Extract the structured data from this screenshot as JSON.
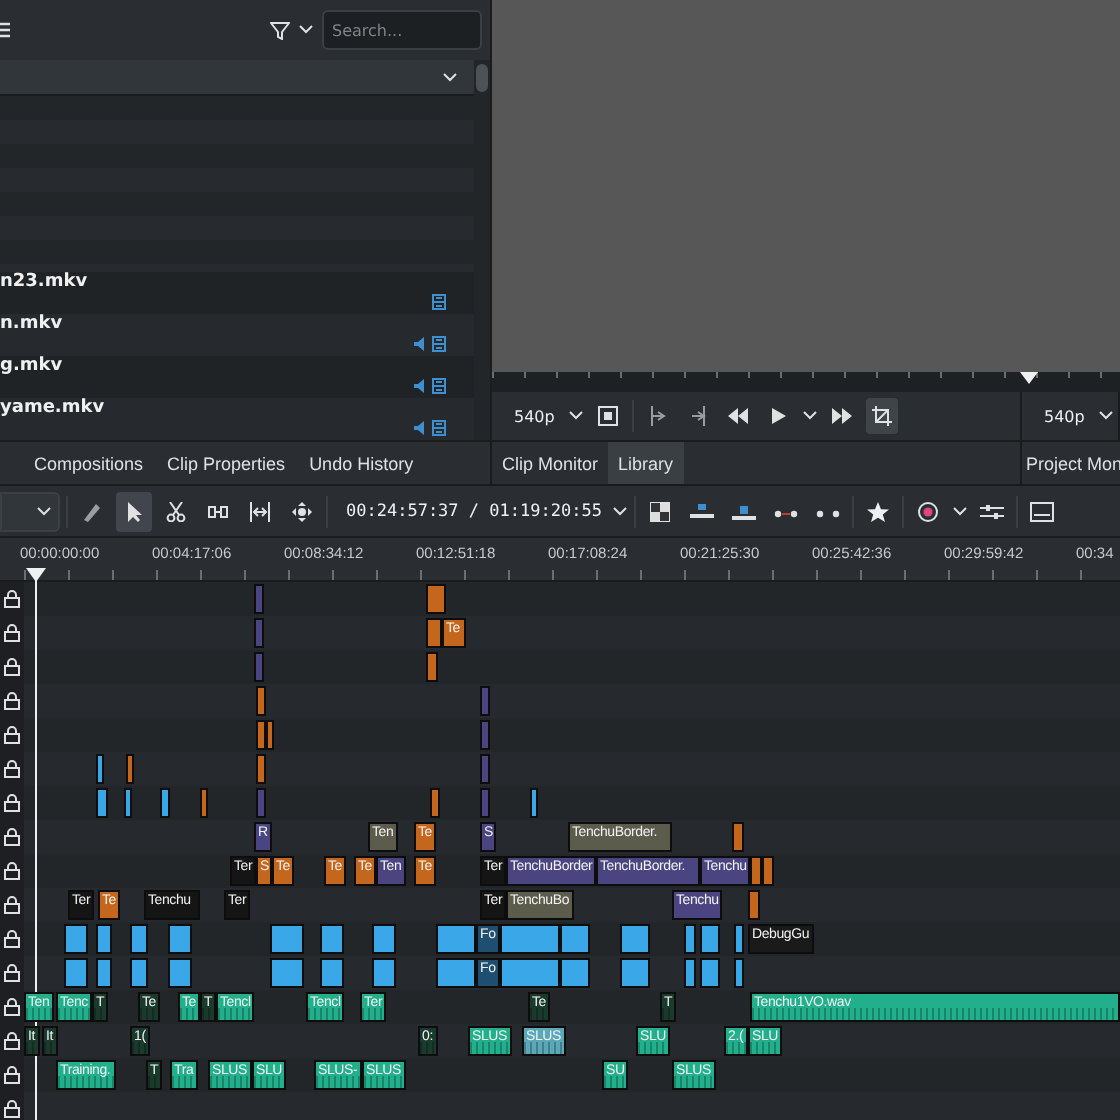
{
  "bin": {
    "search": {
      "placeholder": "Search..."
    },
    "items": [
      {
        "name": "n23.mkv",
        "audio": false
      },
      {
        "name": "n.mkv",
        "audio": true
      },
      {
        "name": "g.mkv",
        "audio": true
      },
      {
        "name": "yame.mkv",
        "audio": true
      }
    ]
  },
  "dock_tabs": [
    {
      "label": "Compositions",
      "selected": false
    },
    {
      "label": "Clip Properties",
      "selected": false
    },
    {
      "label": "Undo History",
      "selected": false
    }
  ],
  "clip_monitor": {
    "resolution": "540p",
    "crop_on": true,
    "tabs": [
      {
        "label": "Clip Monitor",
        "selected": false
      },
      {
        "label": "Library",
        "selected": true
      }
    ]
  },
  "project_monitor": {
    "resolution": "540p",
    "tab": "Project Mon"
  },
  "timeline": {
    "tools": [
      {
        "kind": "edit-mode",
        "selected": false
      },
      {
        "kind": "select",
        "selected": true
      },
      {
        "kind": "razor",
        "selected": false
      },
      {
        "kind": "spacer",
        "selected": false
      },
      {
        "kind": "ripple",
        "selected": false
      },
      {
        "kind": "slip",
        "selected": false
      }
    ],
    "timecode": "00:24:57:37 / 01:19:20:55",
    "ruler": [
      "00:00:00:00",
      "00:04:17:06",
      "00:08:34:12",
      "00:12:51:18",
      "00:17:08:24",
      "00:21:25:30",
      "00:25:42:36",
      "00:29:59:42",
      "00:34"
    ],
    "tracks": [
      {
        "locked": true,
        "clips": [
          {
            "color": "#4a4580"
          },
          {
            "color": "#c4661c"
          }
        ]
      },
      {
        "locked": true,
        "clips": [
          {
            "color": "#4a4580"
          },
          {
            "color": "#c4661c"
          },
          {
            "color": "#c4661c",
            "label": "Te"
          }
        ]
      },
      {
        "locked": true,
        "clips": [
          {
            "color": "#4a4580"
          },
          {
            "color": "#c4661c"
          }
        ]
      },
      {
        "locked": true,
        "clips": [
          {
            "color": "#c4661c"
          },
          {
            "color": "#4a4580"
          }
        ]
      },
      {
        "locked": true,
        "clips": [
          {
            "color": "#c4661c"
          },
          {
            "color": "#c4661c"
          },
          {
            "color": "#4a4580"
          }
        ]
      },
      {
        "locked": true,
        "clips": [
          {
            "color": "#3aa8e8"
          },
          {
            "color": "#c4661c"
          },
          {
            "color": "#c4661c"
          },
          {
            "color": "#4a4580"
          }
        ]
      },
      {
        "locked": true,
        "clips": [
          {
            "color": "#3aa8e8"
          },
          {
            "color": "#3aa8e8"
          },
          {
            "color": "#3aa8e8"
          },
          {
            "color": "#c4661c"
          },
          {
            "color": "#4a4580"
          },
          {
            "color": "#c4661c"
          },
          {
            "color": "#4a4580"
          },
          {
            "color": "#3aa8e8"
          }
        ]
      },
      {
        "locked": true,
        "clips": [
          {
            "color": "#4a4580",
            "label": "R"
          },
          {
            "color": "#5c5c4c",
            "label": "Ten"
          },
          {
            "color": "#c4661c",
            "label": "Te"
          },
          {
            "color": "#4a4580",
            "label": "S"
          },
          {
            "color": "#5c5c4c",
            "label": "TenchuBorder."
          },
          {
            "color": "#c4661c"
          }
        ]
      },
      {
        "locked": true,
        "clips": [
          {
            "color": "#151515",
            "label": "Ter"
          },
          {
            "color": "#c4661c",
            "label": "S"
          },
          {
            "color": "#c4661c",
            "label": "Te"
          },
          {
            "color": "#c4661c",
            "label": "Te"
          },
          {
            "color": "#c4661c",
            "label": "Te"
          },
          {
            "color": "#4a4580",
            "label": "Ten"
          },
          {
            "color": "#c4661c",
            "label": "Te"
          },
          {
            "color": "#151515",
            "label": "Ter"
          },
          {
            "color": "#4a4580",
            "label": "TenchuBorder"
          },
          {
            "color": "#4a4580",
            "label": "TenchuBorder."
          },
          {
            "color": "#4a4580",
            "label": "Tenchu"
          },
          {
            "color": "#c4661c"
          },
          {
            "color": "#c4661c"
          }
        ]
      },
      {
        "locked": true,
        "clips": [
          {
            "color": "#151515",
            "label": "Ter"
          },
          {
            "color": "#c4661c",
            "label": "Te"
          },
          {
            "color": "#151515",
            "label": "Tenchu"
          },
          {
            "color": "#151515",
            "label": "Ter"
          },
          {
            "color": "#151515",
            "label": "Ter"
          },
          {
            "color": "#5c5c4c",
            "label": "TenchuBo"
          },
          {
            "color": "#4a4580",
            "label": "Tenchu"
          },
          {
            "color": "#c4661c"
          }
        ]
      },
      {
        "locked": true,
        "clips": [
          {
            "color": "#3aa8e8"
          },
          {
            "color": "#3aa8e8"
          },
          {
            "color": "#3aa8e8"
          },
          {
            "color": "#3aa8e8"
          },
          {
            "color": "#3aa8e8"
          },
          {
            "color": "#3aa8e8"
          },
          {
            "color": "#3aa8e8"
          },
          {
            "color": "#3aa8e8"
          },
          {
            "color": "#1f4f70",
            "label": "Fo"
          },
          {
            "color": "#3aa8e8"
          },
          {
            "color": "#3aa8e8"
          },
          {
            "color": "#3aa8e8"
          },
          {
            "color": "#3aa8e8"
          },
          {
            "color": "#3aa8e8"
          },
          {
            "color": "#3aa8e8"
          },
          {
            "color": "#1a1a1a",
            "label": "DebugGu"
          }
        ]
      },
      {
        "locked": true,
        "clips": [
          {
            "color": "#3aa8e8"
          },
          {
            "color": "#3aa8e8"
          },
          {
            "color": "#3aa8e8"
          },
          {
            "color": "#3aa8e8"
          },
          {
            "color": "#3aa8e8"
          },
          {
            "color": "#3aa8e8"
          },
          {
            "color": "#3aa8e8"
          },
          {
            "color": "#3aa8e8"
          },
          {
            "color": "#1f4f70",
            "label": "Fo"
          },
          {
            "color": "#3aa8e8"
          },
          {
            "color": "#3aa8e8"
          },
          {
            "color": "#3aa8e8"
          },
          {
            "color": "#3aa8e8"
          },
          {
            "color": "#3aa8e8"
          },
          {
            "color": "#3aa8e8"
          }
        ]
      },
      {
        "locked": true,
        "clips": [
          {
            "color": "#22b08c",
            "label": "Ten"
          },
          {
            "color": "#22b08c",
            "label": "Tenc"
          },
          {
            "color": "#1a3a2e",
            "label": "T"
          },
          {
            "color": "#1a3a2e",
            "label": "Te"
          },
          {
            "color": "#22b08c",
            "label": "Te"
          },
          {
            "color": "#1a3a2e",
            "label": "T"
          },
          {
            "color": "#22b08c",
            "label": "Tencl"
          },
          {
            "color": "#22b08c",
            "label": "Tencl"
          },
          {
            "color": "#22b08c",
            "label": "Ter"
          },
          {
            "color": "#1a3a2e",
            "label": "Te"
          },
          {
            "color": "#1a3a2e",
            "label": "T"
          },
          {
            "color": "#22b08c",
            "label": "Tenchu1VO.wav"
          }
        ]
      },
      {
        "locked": true,
        "clips": [
          {
            "color": "#1a3a2e",
            "label": "It"
          },
          {
            "color": "#1a3a2e",
            "label": "It"
          },
          {
            "color": "#1a3a2e",
            "label": "1("
          },
          {
            "color": "#1a3a2e",
            "label": "0:"
          },
          {
            "color": "#22b08c",
            "label": "SLUS"
          },
          {
            "color": "#5aa8b8",
            "label": "SLUS"
          },
          {
            "color": "#22b08c",
            "label": "SLU"
          },
          {
            "color": "#22b08c",
            "label": "2.("
          },
          {
            "color": "#22b08c",
            "label": "SLU"
          }
        ]
      },
      {
        "locked": true,
        "clips": [
          {
            "color": "#22b08c",
            "label": "Training."
          },
          {
            "color": "#1a3a2e",
            "label": "T"
          },
          {
            "color": "#22b08c",
            "label": "Tra"
          },
          {
            "color": "#22b08c",
            "label": "SLUS"
          },
          {
            "color": "#22b08c",
            "label": "SLU"
          },
          {
            "color": "#22b08c",
            "label": "SLUS-"
          },
          {
            "color": "#22b08c",
            "label": "SLUS"
          },
          {
            "color": "#22b08c",
            "label": "SU"
          },
          {
            "color": "#22b08c",
            "label": "SLUS"
          }
        ]
      },
      {
        "locked": true
      }
    ]
  }
}
